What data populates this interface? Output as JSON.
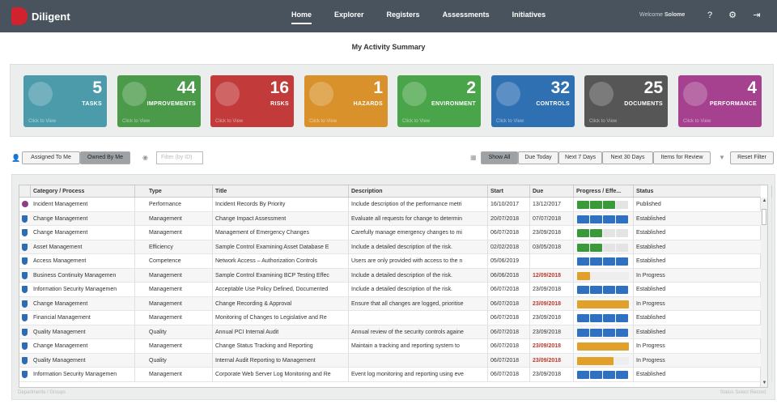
{
  "app": {
    "name": "Diligent"
  },
  "nav": [
    {
      "label": "Home",
      "active": true
    },
    {
      "label": "Explorer"
    },
    {
      "label": "Registers"
    },
    {
      "label": "Assessments"
    },
    {
      "label": "Initiatives"
    }
  ],
  "user": {
    "welcome": "Welcome",
    "name": "Solome"
  },
  "page": {
    "title": "My Activity Summary"
  },
  "tiles": [
    {
      "count": "5",
      "label": "TASKS",
      "color": "#4b9bab",
      "icon": "pencil-icon"
    },
    {
      "count": "44",
      "label": "IMPROVEMENTS",
      "color": "#4a9a4a",
      "icon": "arrow-up-icon"
    },
    {
      "count": "16",
      "label": "RISKS",
      "color": "#c33a3a",
      "icon": "warning-icon"
    },
    {
      "count": "1",
      "label": "HAZARDS",
      "color": "#d9922b",
      "icon": "heartbeat-icon"
    },
    {
      "count": "2",
      "label": "ENVIRONMENT",
      "color": "#4aa54a",
      "icon": "globe-icon"
    },
    {
      "count": "32",
      "label": "CONTROLS",
      "color": "#2f70b2",
      "icon": "shield-icon"
    },
    {
      "count": "25",
      "label": "DOCUMENTS",
      "color": "#565656",
      "icon": "book-icon"
    },
    {
      "count": "4",
      "label": "PERFORMANCE",
      "color": "#a5418e",
      "icon": "pie-icon"
    }
  ],
  "tile_click": "Click to View",
  "filters": {
    "assigned": "Assigned To Me",
    "owned": "Owned By Me",
    "filter_placeholder": "Filter (by ID)",
    "show_all": "Show All",
    "due_today": "Due Today",
    "next7": "Next 7 Days",
    "next30": "Next 30 Days",
    "review": "Items for Review",
    "reset": "Reset Filter"
  },
  "columns": [
    "Category / Process",
    "Type",
    "Title",
    "Description",
    "Start",
    "Due",
    "Progress / Effe...",
    "Status"
  ],
  "rows": [
    {
      "icon": "incident",
      "category": "Incident Management",
      "type": "Performance",
      "title": "Incident Records By Priority",
      "desc": "Include description of the performance metri",
      "start": "16/10/2017",
      "due": "13/12/2017",
      "due_red": false,
      "prog": "seg",
      "segs": 3,
      "status": "Published"
    },
    {
      "icon": "shield",
      "category": "Change Management",
      "type": "Management",
      "title": "Change Impact Assessment",
      "desc": "Evaluate all requests for change to determin",
      "start": "20/07/2018",
      "due": "07/07/2018",
      "due_red": false,
      "prog": "seg",
      "segs": 4,
      "status": "Established"
    },
    {
      "icon": "shield",
      "category": "Change Management",
      "type": "Management",
      "title": "Management of Emergency Changes",
      "desc": "Carefully manage emergency changes to mi",
      "start": "06/07/2018",
      "due": "23/09/2018",
      "due_red": false,
      "prog": "seg",
      "segs": 2,
      "status": "Established"
    },
    {
      "icon": "shield",
      "category": "Asset Management",
      "type": "Efficiency",
      "title": "Sample Control Examining Asset Database E",
      "desc": "Include a detailed description of the risk.",
      "start": "02/02/2018",
      "due": "03/05/2018",
      "due_red": false,
      "prog": "seg",
      "segs": 2,
      "status": "Established"
    },
    {
      "icon": "shield",
      "category": "Access Management",
      "type": "Competence",
      "title": "Network Access – Authorization Controls",
      "desc": "Users are only provided with access to the n",
      "start": "05/06/2019",
      "due": "",
      "due_red": false,
      "prog": "seg",
      "segs": 4,
      "status": "Established"
    },
    {
      "icon": "shield",
      "category": "Business Continuity Managemen",
      "type": "Management",
      "title": "Sample Control Examining BCP Testing Effec",
      "desc": "Include a detailed description of the risk.",
      "start": "06/06/2018",
      "due": "12/09/2018",
      "due_red": true,
      "prog": "fill",
      "fill": 0.25,
      "status": "In Progress"
    },
    {
      "icon": "shield",
      "category": "Information Security Managemen",
      "type": "Management",
      "title": "Acceptable Use Policy Defined, Documented",
      "desc": "Include a detailed description of the risk.",
      "start": "06/07/2018",
      "due": "23/09/2018",
      "due_red": false,
      "prog": "seg",
      "segs": 4,
      "status": "Established"
    },
    {
      "icon": "shield",
      "category": "Change Management",
      "type": "Management",
      "title": "Change Recording & Approval",
      "desc": "Ensure that all changes are logged, prioritise",
      "start": "06/07/2018",
      "due": "23/09/2018",
      "due_red": true,
      "prog": "fill",
      "fill": 1,
      "status": "In Progress"
    },
    {
      "icon": "shield",
      "category": "Financial Management",
      "type": "Management",
      "title": "Monitoring of Changes to Legislative and Re",
      "desc": "",
      "start": "06/07/2018",
      "due": "23/09/2018",
      "due_red": false,
      "prog": "seg",
      "segs": 4,
      "status": "Established"
    },
    {
      "icon": "shield",
      "category": "Quality Management",
      "type": "Quality",
      "title": "Annual PCI Internal Audit",
      "desc": "Annual review of the security controls againe",
      "start": "06/07/2018",
      "due": "23/09/2018",
      "due_red": false,
      "prog": "seg",
      "segs": 4,
      "status": "Established"
    },
    {
      "icon": "shield",
      "category": "Change Management",
      "type": "Management",
      "title": "Change Status Tracking and Reporting",
      "desc": "Maintain a tracking and reporting system to",
      "start": "06/07/2018",
      "due": "23/09/2018",
      "due_red": true,
      "prog": "fill",
      "fill": 1,
      "status": "In Progress"
    },
    {
      "icon": "shield",
      "category": "Quality Management",
      "type": "Quality",
      "title": "Internal Audit Reporting to Management",
      "desc": "",
      "start": "06/07/2018",
      "due": "23/09/2018",
      "due_red": true,
      "prog": "fill",
      "fill": 0.7,
      "status": "In Progress"
    },
    {
      "icon": "shield",
      "category": "Information Security Managemen",
      "type": "Management",
      "title": "Corporate Web Server Log Monitoring and Re",
      "desc": "Event log monitoring and reporting using eve",
      "start": "06/07/2018",
      "due": "23/09/2018",
      "due_red": false,
      "prog": "seg",
      "segs": 4,
      "status": "Established"
    }
  ],
  "footer": {
    "left": "Departments / Groups",
    "right": "Status  Select Record"
  },
  "colors": {
    "seg_blue": "#2f70c0",
    "seg_green": "#3a9a3a",
    "fill_orange": "#e0a02a",
    "red_due": "#c0392b"
  }
}
